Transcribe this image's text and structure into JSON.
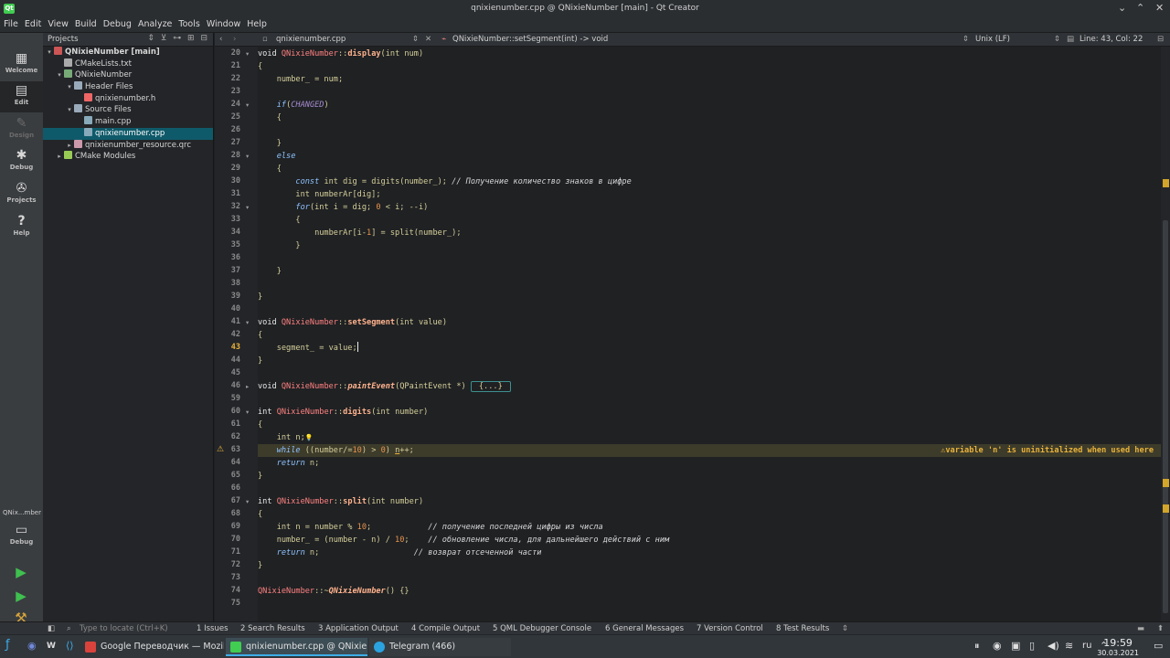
{
  "window": {
    "title": "qnixienumber.cpp @ QNixieNumber [main] - Qt Creator"
  },
  "menu": [
    "File",
    "Edit",
    "View",
    "Build",
    "Debug",
    "Analyze",
    "Tools",
    "Window",
    "Help"
  ],
  "modes": [
    {
      "label": "Welcome",
      "icon": "grid-icon"
    },
    {
      "label": "Edit",
      "icon": "document-icon"
    },
    {
      "label": "Design",
      "icon": "pen-icon"
    },
    {
      "label": "Debug",
      "icon": "bug-icon"
    },
    {
      "label": "Projects",
      "icon": "wrench-icon"
    },
    {
      "label": "Help",
      "icon": "help-icon"
    }
  ],
  "target": {
    "name": "QNix...mber",
    "mode": "Debug"
  },
  "projects": {
    "header": "Projects",
    "tree": [
      {
        "label": "QNixieNumber [main]",
        "depth": 0,
        "expanded": true,
        "bold": true,
        "icon": "project-icon"
      },
      {
        "label": "CMakeLists.txt",
        "depth": 1,
        "icon": "cmake-file-icon"
      },
      {
        "label": "QNixieNumber",
        "depth": 1,
        "expanded": true,
        "icon": "target-icon"
      },
      {
        "label": "Header Files",
        "depth": 2,
        "expanded": true,
        "icon": "folder-icon"
      },
      {
        "label": "qnixienumber.h",
        "depth": 3,
        "icon": "header-file-icon"
      },
      {
        "label": "Source Files",
        "depth": 2,
        "expanded": true,
        "icon": "folder-icon"
      },
      {
        "label": "main.cpp",
        "depth": 3,
        "icon": "cpp-file-icon"
      },
      {
        "label": "qnixienumber.cpp",
        "depth": 3,
        "icon": "cpp-file-icon",
        "selected": true
      },
      {
        "label": "qnixienumber_resource.qrc",
        "depth": 2,
        "collapsed": true,
        "icon": "resource-icon"
      },
      {
        "label": "CMake Modules",
        "depth": 1,
        "collapsed": true,
        "icon": "modules-icon"
      }
    ]
  },
  "editor": {
    "file": "qnixienumber.cpp",
    "symbol": "QNixieNumber::setSegment(int) -> void",
    "line_ending": "Unix (LF)",
    "position": "Line: 43, Col: 22",
    "lines": [
      {
        "n": "20",
        "fold": "▾",
        "tokens": [
          [
            "void ",
            "kw"
          ],
          [
            "QNixieNumber",
            "cls"
          ],
          [
            "::",
            ""
          ],
          [
            "display",
            "fn"
          ],
          [
            "(int num)",
            ""
          ]
        ]
      },
      {
        "n": "21",
        "tokens": [
          [
            "{",
            ""
          ]
        ]
      },
      {
        "n": "22",
        "tokens": [
          [
            "    number_ = num;",
            ""
          ]
        ]
      },
      {
        "n": "23",
        "tokens": []
      },
      {
        "n": "24",
        "fold": "▾",
        "tokens": [
          [
            "    ",
            ""
          ],
          [
            "if",
            "kwi"
          ],
          [
            "(",
            ""
          ],
          [
            "CHANGED",
            "macro"
          ],
          [
            ")",
            ""
          ]
        ]
      },
      {
        "n": "25",
        "tokens": [
          [
            "    {",
            ""
          ]
        ]
      },
      {
        "n": "26",
        "tokens": []
      },
      {
        "n": "27",
        "tokens": [
          [
            "    }",
            ""
          ]
        ]
      },
      {
        "n": "28",
        "fold": "▾",
        "tokens": [
          [
            "    ",
            ""
          ],
          [
            "else",
            "kwi"
          ]
        ]
      },
      {
        "n": "29",
        "tokens": [
          [
            "    {",
            ""
          ]
        ]
      },
      {
        "n": "30",
        "tokens": [
          [
            "        ",
            ""
          ],
          [
            "const",
            "kwi"
          ],
          [
            " int dig = digits(number_); ",
            ""
          ],
          [
            "// Получение количество знаков в цифре",
            "cmt"
          ]
        ]
      },
      {
        "n": "31",
        "tokens": [
          [
            "        int numberAr[dig];",
            ""
          ]
        ]
      },
      {
        "n": "32",
        "fold": "▾",
        "tokens": [
          [
            "        ",
            ""
          ],
          [
            "for",
            "kwi"
          ],
          [
            "(int i = dig; ",
            ""
          ],
          [
            "0",
            "num"
          ],
          [
            " < i; --i)",
            ""
          ]
        ]
      },
      {
        "n": "33",
        "tokens": [
          [
            "        {",
            ""
          ]
        ]
      },
      {
        "n": "34",
        "tokens": [
          [
            "            numberAr[i-",
            ""
          ],
          [
            "1",
            "num"
          ],
          [
            "] = split(number_);",
            ""
          ]
        ]
      },
      {
        "n": "35",
        "tokens": [
          [
            "        }",
            ""
          ]
        ]
      },
      {
        "n": "36",
        "tokens": []
      },
      {
        "n": "37",
        "tokens": [
          [
            "    }",
            ""
          ]
        ]
      },
      {
        "n": "38",
        "tokens": []
      },
      {
        "n": "39",
        "tokens": [
          [
            "}",
            ""
          ]
        ]
      },
      {
        "n": "40",
        "tokens": []
      },
      {
        "n": "41",
        "fold": "▾",
        "tokens": [
          [
            "void ",
            "kw"
          ],
          [
            "QNixieNumber",
            "cls"
          ],
          [
            "::",
            ""
          ],
          [
            "setSegment",
            "fn"
          ],
          [
            "(int value)",
            ""
          ]
        ]
      },
      {
        "n": "42",
        "tokens": [
          [
            "{",
            ""
          ]
        ]
      },
      {
        "n": "43",
        "current": true,
        "tokens": [
          [
            "    segment_ = value;",
            ""
          ]
        ]
      },
      {
        "n": "44",
        "tokens": [
          [
            "}",
            ""
          ]
        ]
      },
      {
        "n": "45",
        "tokens": []
      },
      {
        "n": "46",
        "fold": "▸",
        "tokens": [
          [
            "void ",
            "kw"
          ],
          [
            "QNixieNumber",
            "cls"
          ],
          [
            "::",
            ""
          ],
          [
            "paintEvent",
            "fni"
          ],
          [
            "(QPaintEvent *) ",
            ""
          ],
          [
            "{...}",
            "collapsed"
          ]
        ]
      },
      {
        "n": "59",
        "tokens": []
      },
      {
        "n": "60",
        "fold": "▾",
        "tokens": [
          [
            "int ",
            "kw"
          ],
          [
            "QNixieNumber",
            "cls"
          ],
          [
            "::",
            ""
          ],
          [
            "digits",
            "fn"
          ],
          [
            "(int number)",
            ""
          ]
        ]
      },
      {
        "n": "61",
        "tokens": [
          [
            "{",
            ""
          ]
        ]
      },
      {
        "n": "62",
        "tokens": [
          [
            "    int n;",
            ""
          ],
          [
            "💡",
            "bulb"
          ]
        ]
      },
      {
        "n": "63",
        "warn": true,
        "tokens": [
          [
            "    ",
            ""
          ],
          [
            "while",
            "kwi"
          ],
          [
            " ((number/=",
            ""
          ],
          [
            "10",
            "num"
          ],
          [
            ") > ",
            ""
          ],
          [
            "0",
            "num"
          ],
          [
            ") ",
            ""
          ],
          [
            "n",
            "uline"
          ],
          [
            "++;",
            ""
          ]
        ]
      },
      {
        "n": "64",
        "tokens": [
          [
            "    ",
            ""
          ],
          [
            "return",
            "kwi"
          ],
          [
            " n;",
            ""
          ]
        ]
      },
      {
        "n": "65",
        "tokens": [
          [
            "}",
            ""
          ]
        ]
      },
      {
        "n": "66",
        "tokens": []
      },
      {
        "n": "67",
        "fold": "▾",
        "tokens": [
          [
            "int ",
            "kw"
          ],
          [
            "QNixieNumber",
            "cls"
          ],
          [
            "::",
            ""
          ],
          [
            "split",
            "fn"
          ],
          [
            "(int number)",
            ""
          ]
        ]
      },
      {
        "n": "68",
        "tokens": [
          [
            "{",
            ""
          ]
        ]
      },
      {
        "n": "69",
        "tokens": [
          [
            "    int n = number % ",
            ""
          ],
          [
            "10",
            "num"
          ],
          [
            ";            ",
            ""
          ],
          [
            "// получение последней цифры из числа",
            "cmt"
          ]
        ]
      },
      {
        "n": "70",
        "tokens": [
          [
            "    number_ = (number - n) / ",
            ""
          ],
          [
            "10",
            "num"
          ],
          [
            ";    ",
            ""
          ],
          [
            "// обновление числа, для дальнейшего действий с ним",
            "cmt"
          ]
        ]
      },
      {
        "n": "71",
        "tokens": [
          [
            "    ",
            ""
          ],
          [
            "return",
            "kwi"
          ],
          [
            " n;                    ",
            ""
          ],
          [
            "// возврат отсеченной части",
            "cmt"
          ]
        ]
      },
      {
        "n": "72",
        "tokens": [
          [
            "}",
            ""
          ]
        ]
      },
      {
        "n": "73",
        "tokens": []
      },
      {
        "n": "74",
        "tokens": [
          [
            "QNixieNumber",
            "cls"
          ],
          [
            "::~",
            ""
          ],
          [
            "QNixieNumber",
            "fni"
          ],
          [
            "() {}",
            ""
          ]
        ]
      },
      {
        "n": "75",
        "tokens": []
      }
    ],
    "warning": "variable 'n' is uninitialized when used here"
  },
  "bottom": {
    "locator_placeholder": "Type to locate (Ctrl+K)",
    "tabs": [
      "1 Issues",
      "2 Search Results",
      "3 Application Output",
      "4 Compile Output",
      "5 QML Debugger Console",
      "6 General Messages",
      "7 Version Control",
      "8 Test Results"
    ]
  },
  "taskbar": {
    "tasks": [
      "Google Переводчик — Mozil...",
      "qnixienumber.cpp @ QNixie...",
      "Telegram (466)"
    ],
    "lang": "ru",
    "time": "19:59",
    "date": "30.03.2021"
  },
  "colors": {
    "cls": "#ff8080",
    "fn": "#ffb28d",
    "kw": "#e7e7e7",
    "kwi": "#8fc3ff",
    "macro": "#a68bd0",
    "num": "#e8934d",
    "cmt": "#d7d7d7",
    "accent": "#0f5a6a",
    "warn": "#e8b23a"
  }
}
